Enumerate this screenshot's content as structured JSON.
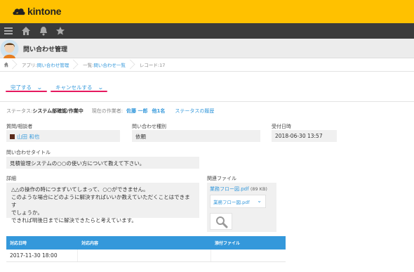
{
  "app": {
    "brand": "kintone",
    "title": "問い合わせ管理"
  },
  "nav": {
    "icons": [
      "menu-icon",
      "home-icon",
      "bell-icon",
      "star-icon"
    ]
  },
  "breadcrumb": {
    "app_prefix": "アプリ:",
    "app_link": "問い合わせ管理",
    "list_prefix": "一覧:",
    "list_link": "問い合わせ一覧",
    "record": "レコード:17"
  },
  "actions": {
    "complete_label": "完了する",
    "cancel_label": "キャンセルする"
  },
  "status": {
    "label": "ステータス:",
    "value": "システム部確認/作業中",
    "assignee_label": "現在の作業者:",
    "assignee": "佐藤 一郎",
    "others": "他1名",
    "history_link": "ステータスの履歴"
  },
  "fields": {
    "requester_label": "質問/相談者",
    "requester_value": "山田 和也",
    "type_label": "問い合わせ種別",
    "type_value": "依頼",
    "date_label": "受付日時",
    "date_value": "2018-06-30 13:57",
    "title_label": "問い合わせタイトル",
    "title_value": "見積管理システムの○○の使い方について教えて下さい。",
    "detail_label": "詳細",
    "detail_lines": [
      "△△の操作の時につまずいてしまって、○○ができません。",
      "このような場合にどのように解決すればいいか教えていただくことはできます",
      "でしょうか。",
      "できれば明後日までに解決できたらと考えています。"
    ],
    "files_label": "関連ファイル",
    "file_name": "業務フロー図.pdf",
    "file_size": "(89 KB)",
    "file_select": "業務フロー図.pdf"
  },
  "table": {
    "headers": [
      "対応日時",
      "対応内容",
      "添付ファイル"
    ],
    "rows": [
      [
        "2017-11-30 18:00",
        "",
        ""
      ]
    ]
  },
  "colors": {
    "brand": "#ffc100",
    "link": "#3498db",
    "accent": "#e5195f",
    "table_header": "#3498db"
  }
}
